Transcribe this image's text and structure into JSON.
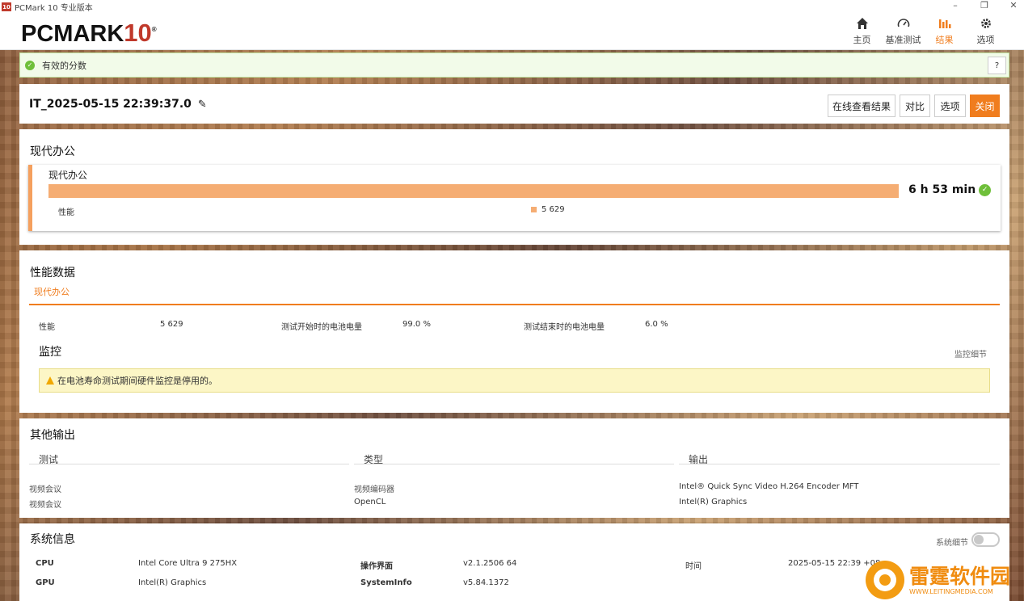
{
  "window": {
    "title": "PCMark 10 专业版本",
    "app_icon": "10"
  },
  "header": {
    "logo_main": "PCMARK",
    "logo_num": "10",
    "logo_reg": "®",
    "nav": [
      {
        "label": "主页",
        "icon": "home-icon"
      },
      {
        "label": "基准测试",
        "icon": "gauge-icon"
      },
      {
        "label": "结果",
        "icon": "bar-chart-icon"
      },
      {
        "label": "选项",
        "icon": "gear-icon"
      }
    ],
    "accent": "#f07d1e"
  },
  "status": {
    "label": "有效的分数",
    "help": "?"
  },
  "result": {
    "title": "IT_2025-05-15 22:39:37.0",
    "buttons": {
      "online": "在线查看结果",
      "compare": "对比",
      "options": "选项",
      "close": "关闭"
    }
  },
  "score_section": {
    "title": "现代办公",
    "box_title": "现代办公",
    "result": "6 h 53 min",
    "row_label": "性能",
    "row_value": "5 629"
  },
  "perf_data": {
    "title": "性能数据",
    "tab": "现代办公",
    "items": [
      {
        "label": "性能",
        "value": "5 629"
      },
      {
        "label": "测试开始时的电池电量",
        "value": "99.0 %"
      },
      {
        "label": "测试结束时的电池电量",
        "value": "6.0 %"
      }
    ],
    "monitor_title": "监控",
    "monitor_link": "监控细节",
    "warning": "在电池寿命测试期间硬件监控是停用的。"
  },
  "other_output": {
    "title": "其他输出",
    "headers": [
      "测试",
      "类型",
      "输出"
    ],
    "rows": [
      [
        "视频会议",
        "视频编码器",
        "Intel® Quick Sync Video H.264 Encoder MFT"
      ],
      [
        "视频会议",
        "OpenCL",
        "Intel(R) Graphics"
      ]
    ]
  },
  "system_info": {
    "title": "系统信息",
    "toggle_label": "系统细节",
    "rows": [
      [
        {
          "label": "CPU",
          "value": "Intel Core Ultra 9 275HX"
        },
        {
          "label": "操作界面",
          "value": "v2.1.2506 64"
        },
        {
          "label": "时间",
          "value": "2025-05-15 22:39 +08"
        }
      ],
      [
        {
          "label": "GPU",
          "value": "Intel(R) Graphics"
        },
        {
          "label": "SystemInfo",
          "value": "v5.84.1372"
        }
      ]
    ]
  },
  "watermark": {
    "cn": "雷霆软件园",
    "en": "WWW.LEITINGMEDIA.COM"
  }
}
